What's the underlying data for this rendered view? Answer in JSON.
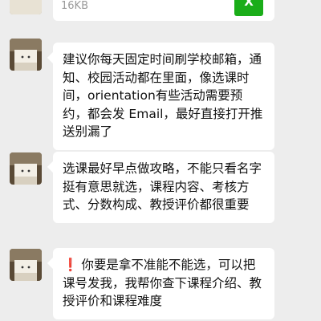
{
  "file_message": {
    "size": "16KB",
    "icon_letter": "X",
    "icon_color": "#1aad19"
  },
  "messages": [
    {
      "text": "建议你每天固定时间刷学校邮箱，通知、校园活动都在里面，像选课时间，orientation有些活动需要预约，都会发 Email，最好直接打开推送别漏了"
    },
    {
      "text": "选课最好早点做攻略，不能只看名字挺有意思就选，课程内容、考核方式、分数构成、教授评价都很重要"
    },
    {
      "warning_icon": "exclamation-icon",
      "text": "你要是拿不准能不能选，可以把课号发我，我帮你查下课程介绍、教授评价和课程难度"
    }
  ]
}
